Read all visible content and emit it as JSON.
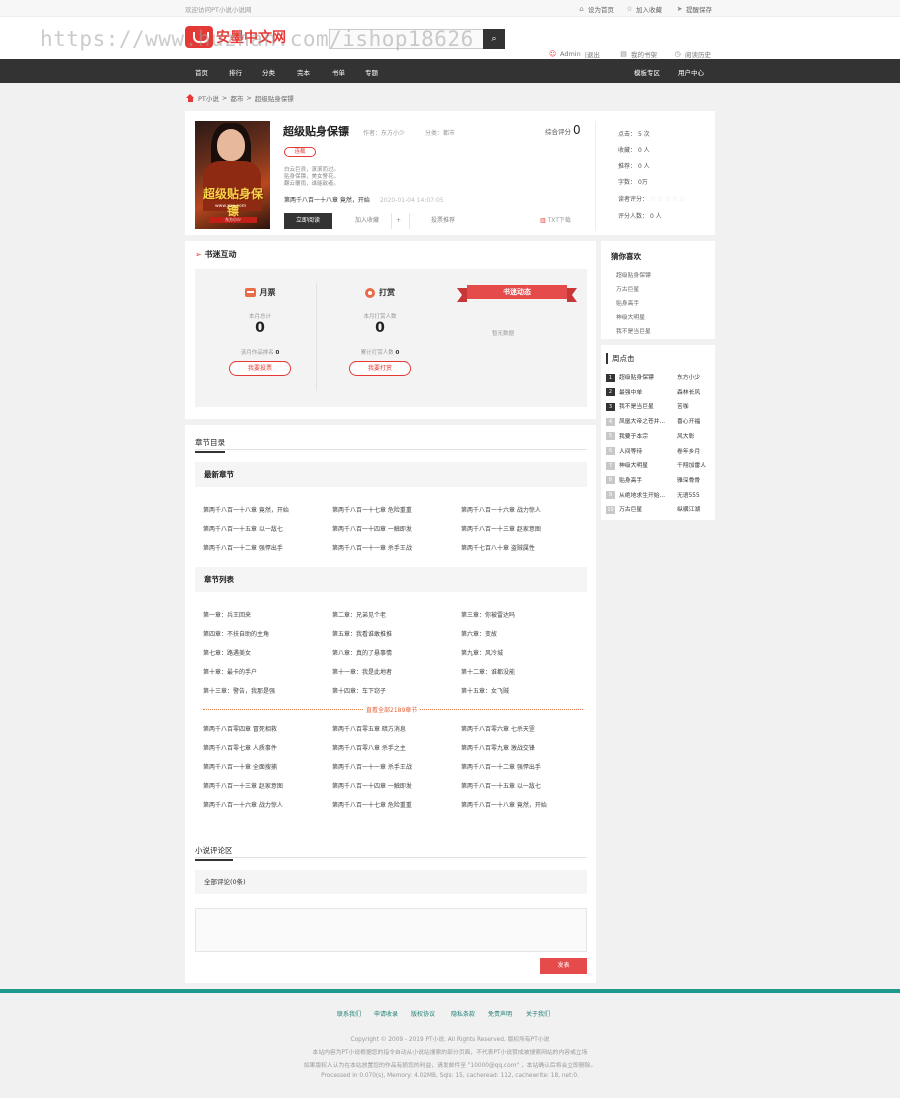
{
  "top": {
    "welcome": "欢迎访问PT小说小说网",
    "links": [
      "设为首页",
      "加入收藏",
      "提醒保存"
    ]
  },
  "header": {
    "logo": "安墨中文网",
    "search_placeholder": "",
    "watermark": "https://www.huzhan.com/ishop18626",
    "user": "Admin",
    "logout": "|退出",
    "bookshelf": "我的书架",
    "history": "阅读历史"
  },
  "nav": {
    "items": [
      "首页",
      "排行",
      "分类",
      "完本",
      "书单",
      "专题"
    ],
    "right": [
      "模板专区",
      "用户中心"
    ]
  },
  "breadcrumb": [
    "PT小说",
    "都市",
    "超级贴身保镖"
  ],
  "book": {
    "title": "超级贴身保镖",
    "author_label": "作者：",
    "author": "东方小少",
    "category_label": "分类：",
    "category": "都市",
    "tag": "连载",
    "intro": [
      "白云巨浪，滚滚而过。",
      "贴身保镖，美女警花。",
      "翻云覆雨，谁能敌者。"
    ],
    "latest_chapter": "第两千八百一十八章 竟然，开始",
    "update_time": "2020-01-04 14:07:05",
    "read_button": "立即阅读",
    "shelf_button": "加入收藏",
    "plus": "+",
    "vote_button": "投票推荐",
    "txt_button": "TXT下载",
    "score_label": "综合评分",
    "score": "0",
    "cover_title": "超级贴身保镖",
    "cover_site": "www.xxx.com",
    "cover_author": "东方小少"
  },
  "stats": [
    {
      "label": "点击：",
      "value": "5 次"
    },
    {
      "label": "收藏：",
      "value": "0 人"
    },
    {
      "label": "推荐：",
      "value": "0 人"
    },
    {
      "label": "字数：",
      "value": "0万"
    },
    {
      "label": "读者评分：",
      "value": "☆☆☆☆☆"
    },
    {
      "label": "评分人数：",
      "value": "0 人"
    }
  ],
  "interaction": {
    "title": "书迷互动",
    "monthly": {
      "title": "月票",
      "label": "本月总计",
      "value": "0",
      "rank_label": "该月作品排名",
      "rank": "0",
      "button": "我要投票"
    },
    "reward": {
      "title": "打赏",
      "label": "本月打赏人数",
      "value": "0",
      "total_label": "累计打赏人数",
      "total": "0",
      "button": "我要打赏"
    },
    "dynamic": {
      "title": "书迷动态",
      "empty": "暂无数据"
    }
  },
  "chapters": {
    "tab": "章节目录",
    "latest_title": "最新章节",
    "latest": [
      "第两千八百一十八章 竟然，开始",
      "第两千八百一十七章 危险重重",
      "第两千八百一十六章 战力惊人",
      "第两千八百一十五章 以一敌七",
      "第两千八百一十四章 一触即发",
      "第两千八百一十三章 赵家意图",
      "第两千八百一十二章 强悍出手",
      "第两千八百一十一章 杀手王战",
      "第两千七百八十章 盗贼属性"
    ],
    "list_title": "章节列表",
    "list": [
      "第一章：兵王回来",
      "第二章：兄弟见个老",
      "第三章：你被雷达吗",
      "第四章：不扶自助的主角",
      "第五章：我看谁敢推推",
      "第六章：变故",
      "第七章：路遇美女",
      "第八章：真的了悬事情",
      "第九章：风冷城",
      "第十章：最卡的手户",
      "第十一章：我是此地者",
      "第十二章：谁都没能",
      "第十三章：警告，我那是强",
      "第十四章：车下窃子",
      "第十五章：女飞贼"
    ],
    "more": "直看全部2189章节",
    "tail": [
      "第两千八百零四章 冒死相救",
      "第两千八百零五章 暗方消息",
      "第两千八百零六章 七杀天罡",
      "第两千八百零七章 人质事件",
      "第两千八百零八章 杀手之主",
      "第两千八百零九章 激战交锋",
      "第两千八百一十章 全面搜捕",
      "第两千八百一十一章 杀手王战",
      "第两千八百一十二章 强悍出手",
      "第两千八百一十三章 赵家意图",
      "第两千八百一十四章 一触即发",
      "第两千八百一十五章 以一敌七",
      "第两千八百一十六章 战力惊人",
      "第两千八百一十七章 危险重重",
      "第两千八百一十八章 竟然，开始"
    ]
  },
  "comments": {
    "tab": "小说评论区",
    "all": "全部评论(0条)",
    "post": "发表"
  },
  "sidebar": {
    "guess_title": "猜你喜欢",
    "guess": [
      "超级贴身保镖",
      "万古巨星",
      "贴身高手",
      "神级大明星",
      "我不是当巨星"
    ],
    "rank_title": "周点击",
    "rank": [
      {
        "n": "1",
        "title": "超级贴身保镖",
        "author": "东方小少"
      },
      {
        "n": "2",
        "title": "最强中单",
        "author": "森林长风"
      },
      {
        "n": "3",
        "title": "我不是当巨星",
        "author": "苦咖"
      },
      {
        "n": "4",
        "title": "凤凰大帝之苍井...",
        "author": "喜心开福"
      },
      {
        "n": "5",
        "title": "我要于本宗",
        "author": "风大彰"
      },
      {
        "n": "6",
        "title": "人间等待",
        "author": "卷年乡月"
      },
      {
        "n": "7",
        "title": "神级大明星",
        "author": "千翔加雷人"
      },
      {
        "n": "8",
        "title": "贴身高手",
        "author": "雅深骨骨"
      },
      {
        "n": "9",
        "title": "从绝地求生开始...",
        "author": "无语555"
      },
      {
        "n": "10",
        "title": "万古巨星",
        "author": "纵横江湖"
      }
    ]
  },
  "colors": {
    "accent": "#e53935",
    "dark": "#333333",
    "teal": "#1d9a8c"
  },
  "footer": {
    "links": [
      "联系我们",
      "申请收录",
      "版权协议",
      "隐私条款",
      "免责声明",
      "关于我们"
    ],
    "copyright": "Copyright © 2009 - 2019 PT小说. All Rights Reserved. 版权所有PT小说",
    "line2": "本站内容为PT小说根据您的指令自动从小说站搜索的部分页面，不代表PT小说赞成被搜索网站的内容或立场",
    "line3": "如果版权人认为在本站放置您的作品有损您的利益，请发邮件至 \"10000@qq.com\" ，本站确认后将会立即删除。",
    "line4": "Processed in 0.070(s), Memory: 4.02MB, Sqls: 15, cacheread: 112, cachewrite: 18, net:0."
  }
}
